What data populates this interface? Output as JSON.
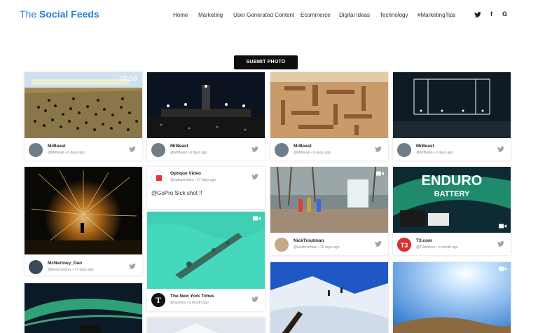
{
  "header": {
    "logo_prefix": "The ",
    "logo_main": "Social Feeds",
    "nav": [
      "Home",
      "Marketing",
      "User Generated Content",
      "Ecommerce",
      "Digital Ideas",
      "Technology",
      "#MarketingTips"
    ],
    "social_icons": [
      "twitter-icon",
      "facebook-icon",
      "google-icon"
    ],
    "social_glyphs": {
      "twitter": "🐦",
      "facebook": "f",
      "google": "G"
    }
  },
  "submit_label": "SUBMIT PHOTO",
  "colors": {
    "accent": "#2a7fd4",
    "twitter": "#9aa3ab"
  },
  "feed": [
    {
      "user": "MrBeast",
      "handle": "@MrBeast",
      "time": "6 days ago",
      "overlay_text": "05:58"
    },
    {
      "user": "MrBeast",
      "handle": "@MrBeast",
      "time": "6 days ago"
    },
    {
      "user": "MrBeast",
      "handle": "@MrBeast",
      "time": "6 days ago"
    },
    {
      "user": "MrBeast",
      "handle": "@MrBeast",
      "time": "6 days ago"
    },
    {
      "user": "McNertney_Dan",
      "handle": "@thencnertney",
      "time": "17 days ago"
    },
    {
      "user": "Optique Video",
      "handle": "@optiquevideo",
      "time": "17 days ago",
      "text": "@GoPro Sick shot !!"
    },
    {
      "user": "NickTroutman",
      "handle": "@nicktroutman",
      "time": "25 days ago"
    },
    {
      "user": "T3.com",
      "handle": "@T3dotcom",
      "time": "a month ago",
      "overlay_big": "ENDURO",
      "overlay_small": "BATTERY"
    },
    {
      "user": "The New York Times",
      "handle": "@nytimes",
      "time": "a month ago"
    }
  ]
}
